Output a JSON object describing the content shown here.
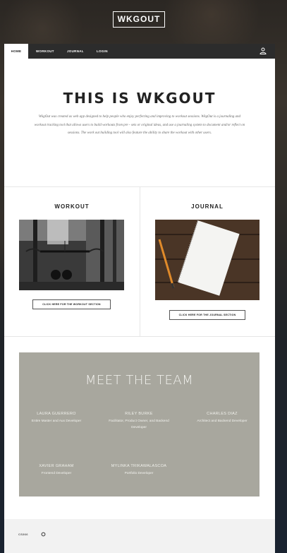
{
  "brand": {
    "logo_text": "WKGOUT"
  },
  "nav": {
    "items": [
      {
        "label": "HOME",
        "active": true
      },
      {
        "label": "WORKOUT"
      },
      {
        "label": "JOURNAL"
      },
      {
        "label": "LOGIN"
      }
    ],
    "user_icon": "user-icon"
  },
  "intro": {
    "title": "THIS IS WKGOUT",
    "text": "WkgOut was created as web app designed to help people who enjoy perfecting and improving to workout sessions. WkgOut is a journaling and workout tracking tool that allows users to build workouts from pre - sets or original ideas, and use a journaling system to document and/or reflect on sessions. The work out building tool will also feature the ability to share the workout with other users."
  },
  "sections": {
    "workout": {
      "title": "WORKOUT",
      "cta": "CLICK HERE FOR THE WORKOUT SECTION"
    },
    "journal": {
      "title": "JOURNAL",
      "cta": "CLICK HERE FOR THE JOURNAL SECTION"
    }
  },
  "team": {
    "title": "MEET THE TEAM",
    "members": [
      {
        "name": "LAURA GUERRERO",
        "role": "Entire Master and Aux Developer"
      },
      {
        "name": "RILEY BURKE",
        "role": "Facilitator, Product Owner, and Backend Developer"
      },
      {
        "name": "CHARLES DIAZ",
        "role": "Architect and Backend Developer"
      },
      {
        "name": "XAVIER GRAHAM",
        "role": "Frontend Developer"
      },
      {
        "name": "MYLINKA TRIKAWALASCOA",
        "role": "Portfolio Developer"
      }
    ]
  },
  "footer": {
    "text": "CS366",
    "icon": "circle-icon"
  },
  "colors": {
    "nav_bg": "#2c2c2c",
    "team_bg": "#a8a79e",
    "footer_bg": "#f2f2f2"
  }
}
